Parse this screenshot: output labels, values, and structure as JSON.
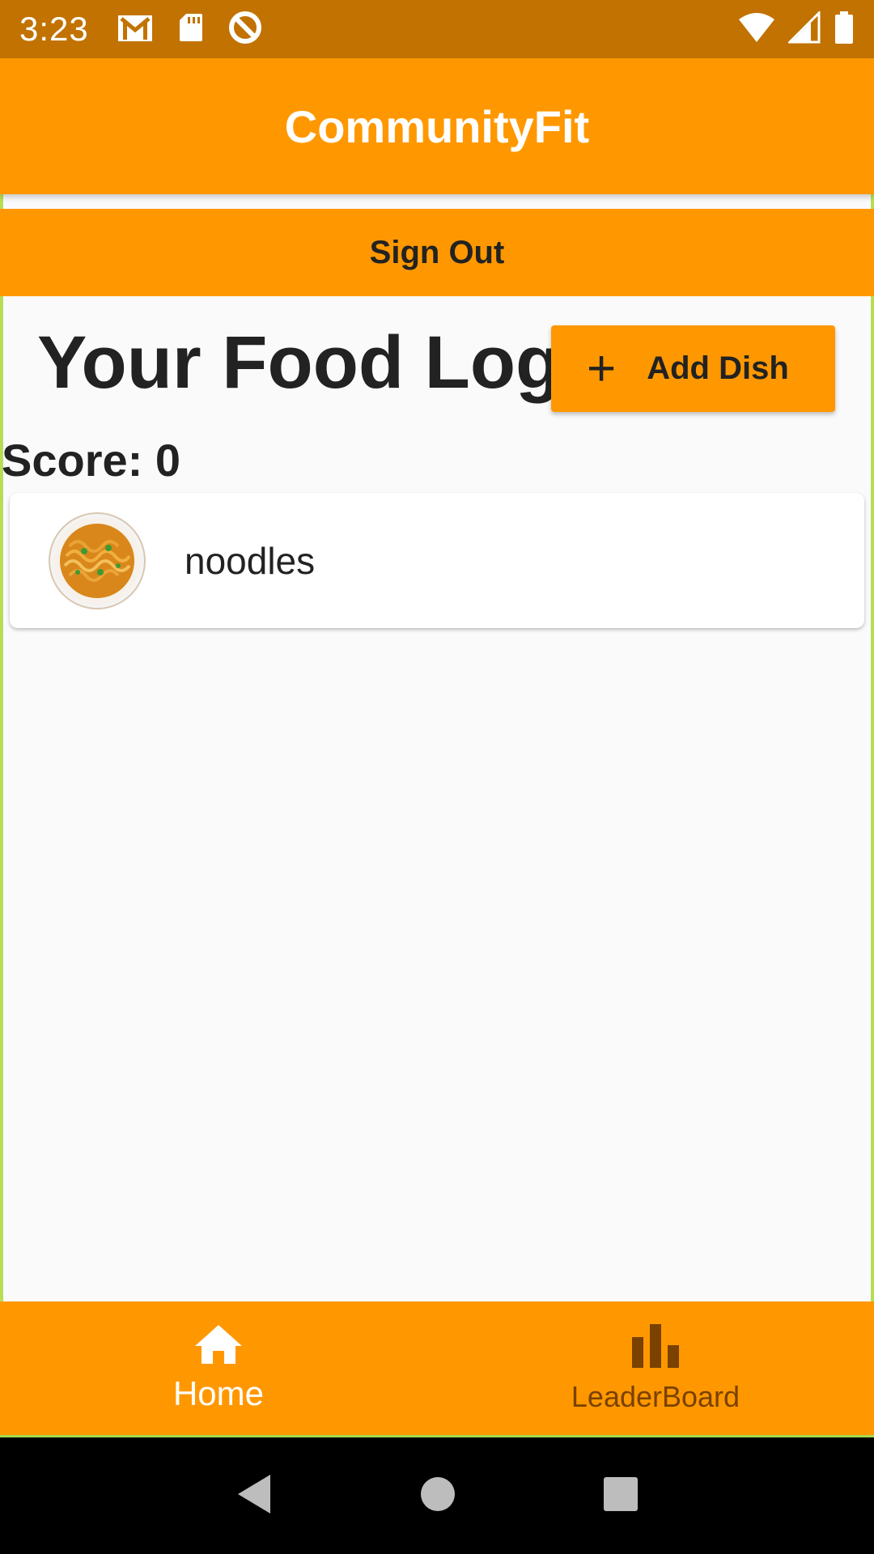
{
  "status_bar": {
    "time": "3:23",
    "left_icons": [
      "gmail-icon",
      "sd-card-icon",
      "do-not-disturb-icon"
    ],
    "right_icons": [
      "wifi-icon",
      "cell-signal-icon",
      "battery-icon"
    ]
  },
  "app_bar": {
    "title": "CommunityFit"
  },
  "sign_out": {
    "label": "Sign Out"
  },
  "food_log": {
    "heading": "Your Food Log",
    "add_button_label": "Add Dish",
    "score_label": "Score: 0",
    "items": [
      {
        "name": "noodles",
        "image": "noodles-plate-image"
      }
    ]
  },
  "bottom_nav": {
    "items": [
      {
        "label": "Home",
        "icon": "home-icon",
        "selected": true
      },
      {
        "label": "LeaderBoard",
        "icon": "bar-chart-icon",
        "selected": false
      }
    ]
  },
  "colors": {
    "primary": "#ff9800",
    "status_bar": "#c17200",
    "background": "#fafafa"
  }
}
